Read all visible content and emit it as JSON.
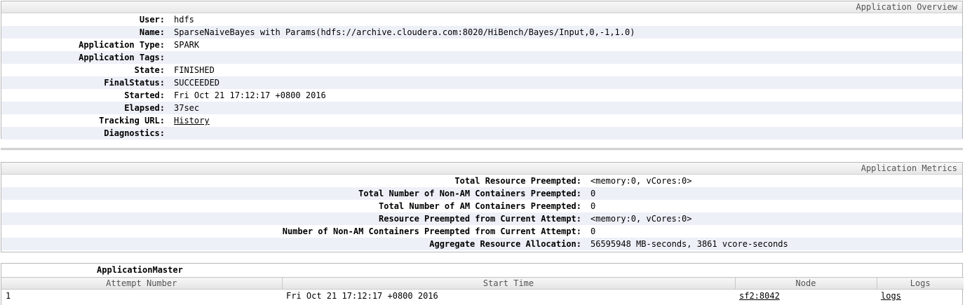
{
  "overview": {
    "header": "Application Overview",
    "rows": [
      {
        "label": "User:",
        "value": "hdfs"
      },
      {
        "label": "Name:",
        "value": "SparseNaiveBayes with Params(hdfs://archive.cloudera.com:8020/HiBench/Bayes/Input,0,-1,1.0)"
      },
      {
        "label": "Application Type:",
        "value": "SPARK"
      },
      {
        "label": "Application Tags:",
        "value": ""
      },
      {
        "label": "State:",
        "value": "FINISHED"
      },
      {
        "label": "FinalStatus:",
        "value": "SUCCEEDED"
      },
      {
        "label": "Started:",
        "value": "Fri Oct 21 17:12:17 +0800 2016"
      },
      {
        "label": "Elapsed:",
        "value": "37sec"
      },
      {
        "label": "Tracking URL:",
        "value": "History"
      },
      {
        "label": "Diagnostics:",
        "value": ""
      }
    ]
  },
  "metrics": {
    "header": "Application Metrics",
    "rows": [
      {
        "label": "Total Resource Preempted:",
        "value": "<memory:0, vCores:0>"
      },
      {
        "label": "Total Number of Non-AM Containers Preempted:",
        "value": "0"
      },
      {
        "label": "Total Number of AM Containers Preempted:",
        "value": "0"
      },
      {
        "label": "Resource Preempted from Current Attempt:",
        "value": "<memory:0, vCores:0>"
      },
      {
        "label": "Number of Non-AM Containers Preempted from Current Attempt:",
        "value": "0"
      },
      {
        "label": "Aggregate Resource Allocation:",
        "value": "56595948 MB-seconds, 3861 vcore-seconds"
      }
    ]
  },
  "app_master": {
    "title": "ApplicationMaster",
    "columns": [
      "Attempt Number",
      "Start Time",
      "Node",
      "Logs"
    ],
    "rows": [
      {
        "attempt": "1",
        "start_time": "Fri Oct 21 17:12:17 +0800 2016",
        "node": "sf2:8042",
        "logs": "logs"
      }
    ]
  }
}
